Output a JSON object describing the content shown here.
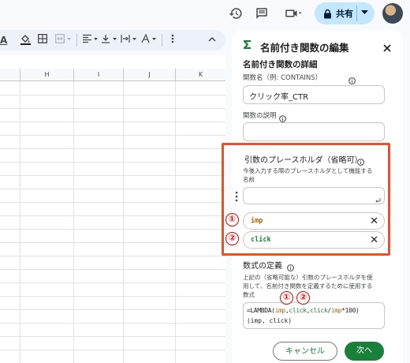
{
  "topbar": {
    "share_label": "共有",
    "icons": [
      "history-icon",
      "comment-icon",
      "video-call-icon",
      "lock-icon",
      "dropdown-icon",
      "avatar"
    ]
  },
  "toolbar": {
    "font_color_label": "A"
  },
  "sheet": {
    "columns": [
      "H",
      "I",
      "J",
      "K"
    ]
  },
  "panel": {
    "title": "名前付き関数の編集",
    "section_header": "名前付き関数の詳細",
    "name_label": "関数名（例: CONTAINS）",
    "name_value": "クリック率_CTR",
    "description_label": "関数の説明",
    "description_value": "",
    "placeholder_header": "引数のプレースホルダ（省略可）",
    "placeholder_help_1": "今後入力する際のプレースホルダとして機能する",
    "placeholder_help_2": "名前",
    "placeholder_input_value": "",
    "args": [
      {
        "marker": "①",
        "name": "imp",
        "color": "#b06000"
      },
      {
        "marker": "②",
        "name": "click",
        "color": "#188038"
      }
    ],
    "formula_header": "数式の定義",
    "formula_help_1": "上記の（省略可能な）引数のプレースホルダを使",
    "formula_help_2": "用して、名前付き関数を定義するために使用する",
    "formula_help_3": "数式",
    "formula_markers": [
      "①",
      "②"
    ],
    "formula": {
      "prefix": "=LAMBDA(",
      "arg1": "imp",
      "comma1": ",",
      "arg2": "click",
      "comma2": ",",
      "arg3": "click",
      "slash": "/",
      "arg4": "imp",
      "tail": "*100)",
      "line2": "(imp, click)"
    },
    "cancel_label": "キャンセル",
    "next_label": "次へ"
  },
  "colors": {
    "highlight": "#e8522a",
    "marker": "#e00000",
    "primary": "#188038",
    "accent": "#0b57d0"
  }
}
